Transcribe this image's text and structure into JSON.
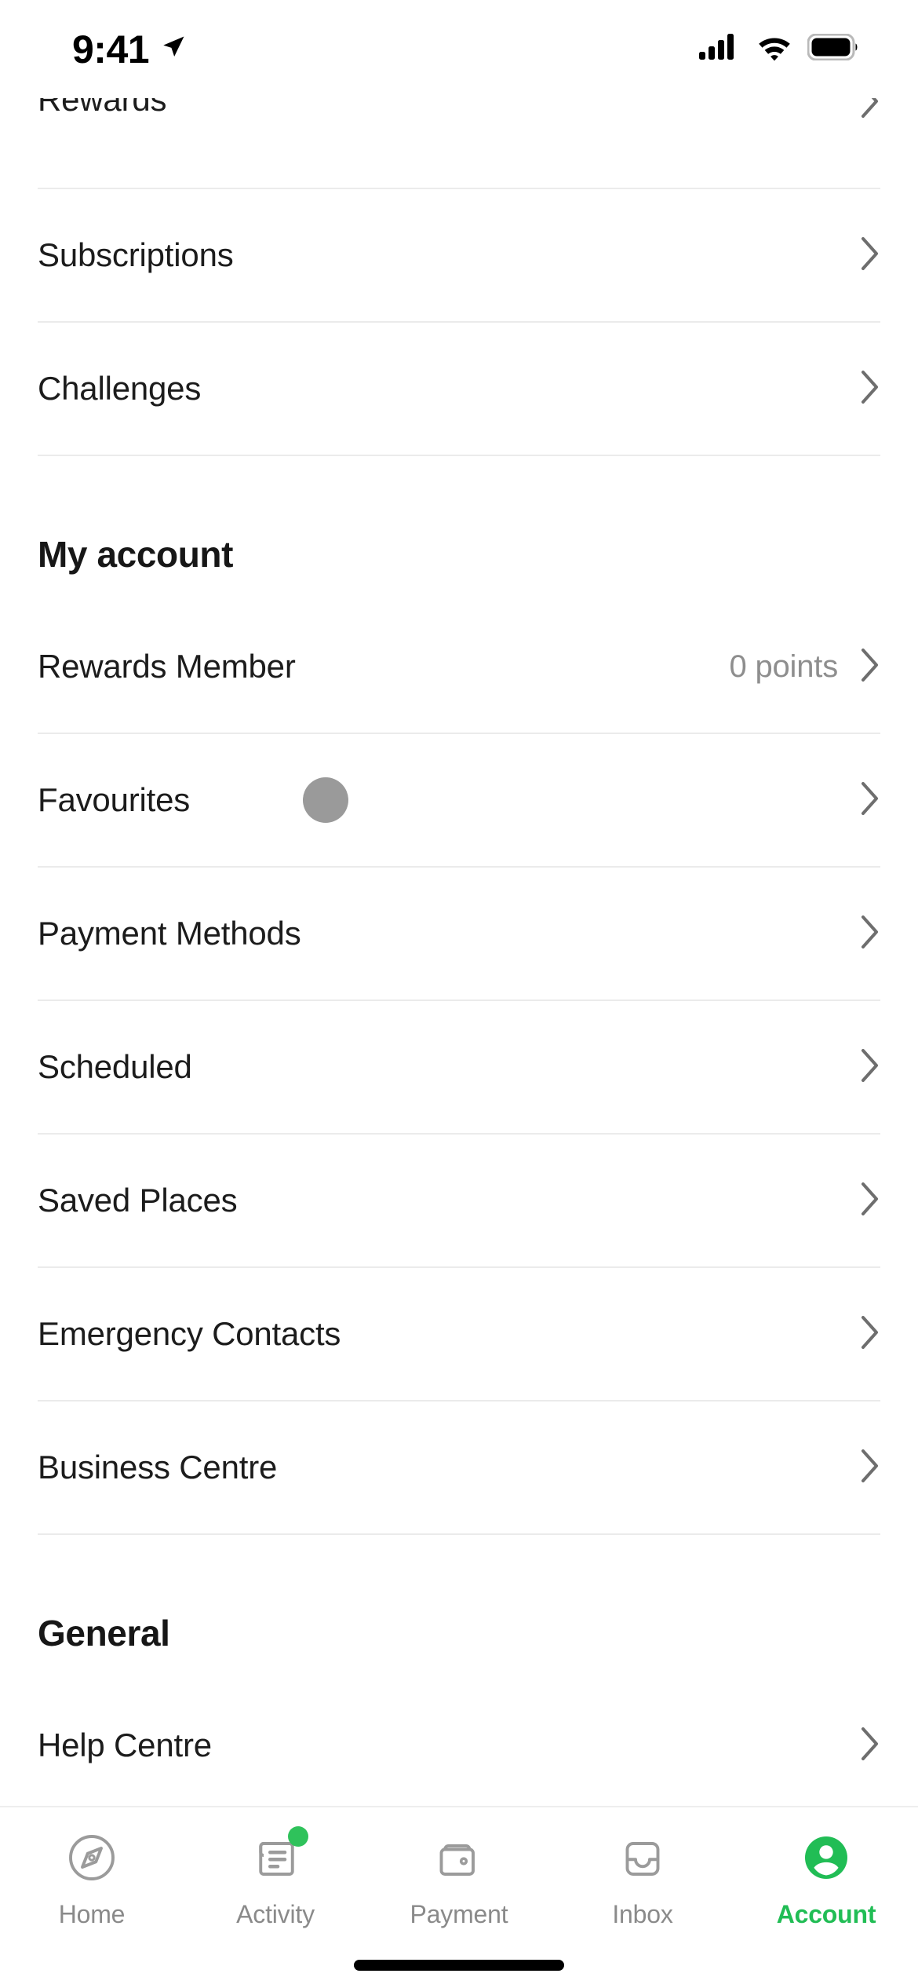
{
  "status_bar": {
    "time": "9:41",
    "location_icon": "location-arrow-icon",
    "cellular_icon": "cellular-signal-icon",
    "wifi_icon": "wifi-icon",
    "battery_icon": "battery-full-icon"
  },
  "colors": {
    "accent_green": "#21bd55",
    "badge_green": "#2fc25b",
    "divider": "#ebebeb",
    "label": "#1c1c1c",
    "secondary_text": "#8e8e8e",
    "tab_inactive": "#8a8a8a",
    "skeleton": "#9a9a9a"
  },
  "top_section": {
    "rows": [
      {
        "label": "Rewards",
        "value": "",
        "chevron": true,
        "clipped": true
      },
      {
        "label": "Subscriptions",
        "value": "",
        "chevron": true,
        "clipped": false
      },
      {
        "label": "Challenges",
        "value": "",
        "chevron": true,
        "clipped": false
      }
    ]
  },
  "my_account": {
    "header": "My account",
    "rows": [
      {
        "label": "Rewards Member",
        "value": "0 points",
        "chevron": true,
        "skeleton": false
      },
      {
        "label": "Favourites",
        "value": "",
        "chevron": true,
        "skeleton": true
      },
      {
        "label": "Payment Methods",
        "value": "",
        "chevron": true,
        "skeleton": false
      },
      {
        "label": "Scheduled",
        "value": "",
        "chevron": true,
        "skeleton": false
      },
      {
        "label": "Saved Places",
        "value": "",
        "chevron": true,
        "skeleton": false
      },
      {
        "label": "Emergency Contacts",
        "value": "",
        "chevron": true,
        "skeleton": false
      },
      {
        "label": "Business Centre",
        "value": "",
        "chevron": true,
        "skeleton": false
      }
    ]
  },
  "general": {
    "header": "General",
    "rows": [
      {
        "label": "Help Centre",
        "value": "",
        "chevron": true,
        "clipped": true
      }
    ]
  },
  "tabbar": {
    "items": [
      {
        "label": "Home",
        "icon": "compass-icon",
        "active": false,
        "badge": false
      },
      {
        "label": "Activity",
        "icon": "receipt-icon",
        "active": false,
        "badge": true
      },
      {
        "label": "Payment",
        "icon": "wallet-icon",
        "active": false,
        "badge": false
      },
      {
        "label": "Inbox",
        "icon": "inbox-tray-icon",
        "active": false,
        "badge": false
      },
      {
        "label": "Account",
        "icon": "account-person-icon",
        "active": true,
        "badge": false
      }
    ]
  }
}
